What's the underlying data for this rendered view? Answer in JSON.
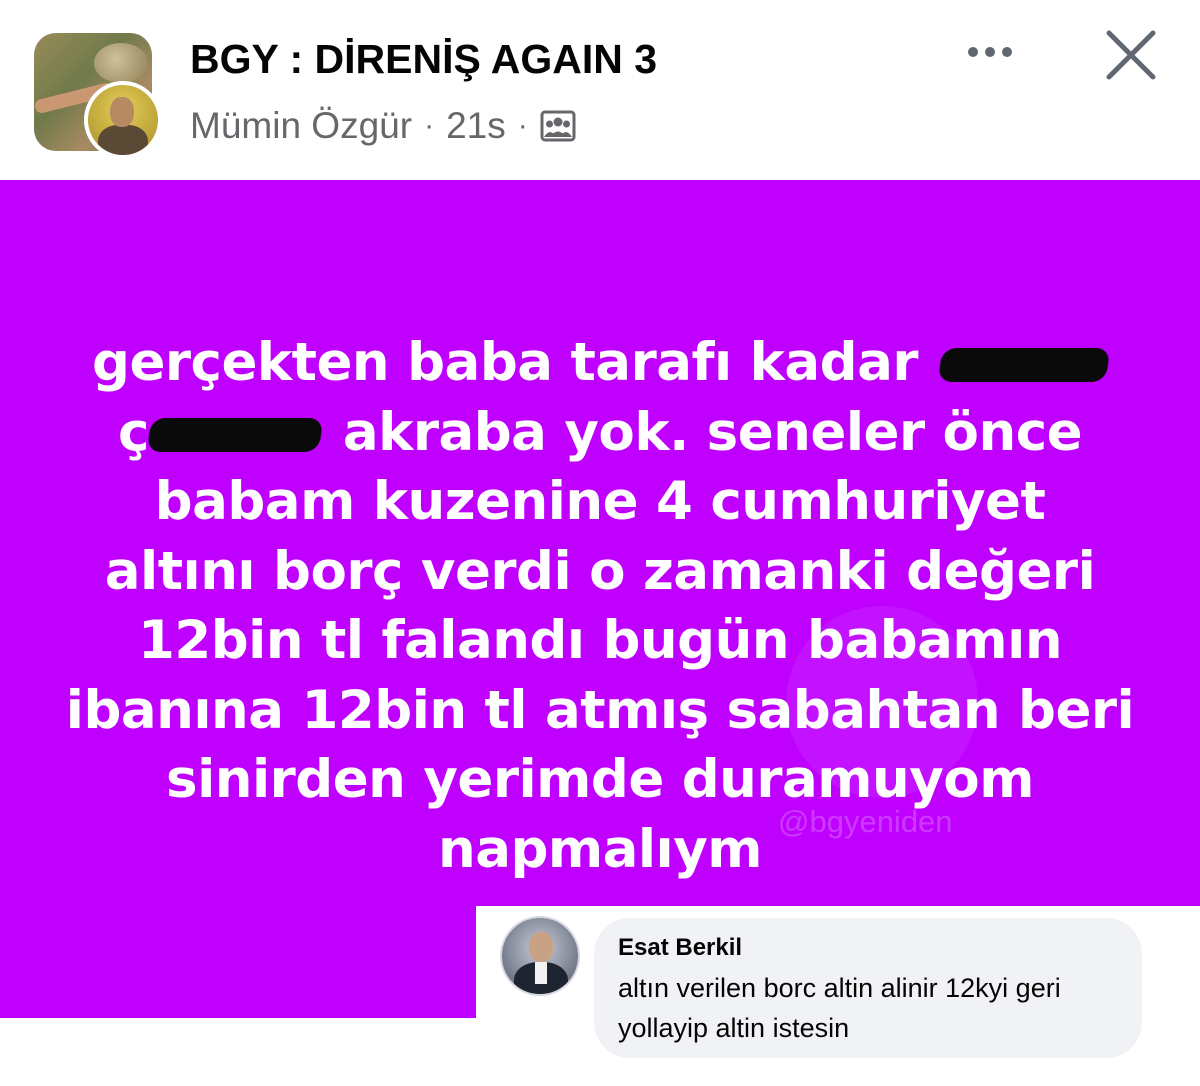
{
  "header": {
    "group_name": "BGY : DİRENİŞ AGAIN 3",
    "author": "Mümin Özgür",
    "separator": "·",
    "timestamp": "21s",
    "audience_icon": "group-audience-icon",
    "more_icon": "more-options-icon",
    "close_icon": "close-icon"
  },
  "post": {
    "background_color": "#bf00ff",
    "lines": {
      "l1_pre": "gerçekten baba tarafı kadar",
      "l2_pre": "ç",
      "l2_post": "akraba yok. seneler önce",
      "l3": "babam kuzenine 4 cumhuriyet",
      "l4": "altını borç verdi o zamanki değeri",
      "l5": "12bin tl falandı bugün babamın",
      "l6": "ibanına 12bin tl atmış sabahtan beri",
      "l7": "sinirden yerimde duramuyom",
      "l8": "napmalıym"
    },
    "watermark_handle": "@bgyeniden"
  },
  "comment": {
    "author": "Esat Berkil",
    "text_line1": "altın verilen borc altin alinir 12kyi geri",
    "text_line2": "yollayip altin istesin"
  }
}
